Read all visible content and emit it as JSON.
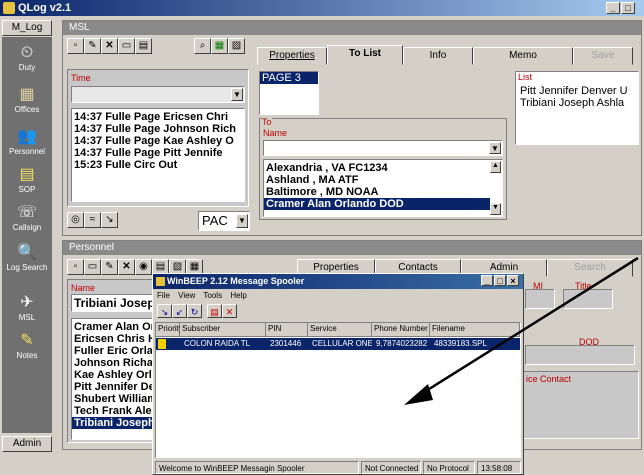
{
  "app": {
    "title": "QLog v2.1"
  },
  "nav": {
    "tab": "M_Log",
    "items": [
      {
        "label": "Duty",
        "icon": "clock-icon"
      },
      {
        "label": "Offices",
        "icon": "building-icon"
      },
      {
        "label": "Personnel",
        "icon": "people-icon"
      },
      {
        "label": "SOP",
        "icon": "book-icon"
      },
      {
        "label": "Callsign",
        "icon": "phone-icon"
      },
      {
        "label": "Log Search",
        "icon": "magnifier-icon"
      },
      {
        "label": "MSL",
        "icon": "satellite-icon"
      },
      {
        "label": "Notes",
        "icon": "notes-icon"
      }
    ],
    "admin": "Admin"
  },
  "msl": {
    "title": "MSL",
    "time_label": "Time",
    "log": [
      "14:37 Fulle Page Ericsen Chri",
      "14:37 Fulle Page Johnson Rich",
      "14:37 Fulle Page Kae Ashley O",
      "14:37 Fulle Page Pitt Jennife",
      "15:23 Fulle Circ Out"
    ],
    "pac": "PAC",
    "tabs": {
      "properties": "Properties",
      "to_list": "To List",
      "info": "Info",
      "memo": "Memo",
      "save": "Save"
    },
    "page_item": "PAGE 3",
    "to_label": "To",
    "name_label": "Name",
    "to_names": [
      "Alexandria , VA FC1234",
      "Ashland , MA ATF",
      "Baltimore , MD NOAA",
      "Cramer Alan Orlando DOD"
    ],
    "list_label": "List",
    "list_items": [
      "Pitt Jennifer Denver U",
      "Tribiani Joseph Ashla"
    ]
  },
  "personnel": {
    "title": "Personnel",
    "name_label": "Name",
    "name_value": "Tribiani Joseph",
    "tabs": {
      "properties": "Properties",
      "contacts": "Contacts",
      "admin": "Admin",
      "search": "Search"
    },
    "names": [
      "Cramer Alan Or",
      "Ericsen Chris H",
      "Fuller Eric Orla",
      "Johnson Richa",
      "Kae Ashley Orla",
      "Pitt Jennifer De",
      "Shubert William",
      "Tech Frank Ale",
      "Tribiani Joseph"
    ],
    "mi_label": "MI",
    "title_label": "Title",
    "dod": "DOD",
    "contact_label": "ice Contact"
  },
  "winbeep": {
    "title": "WinBEEP 2.12 Message Spooler",
    "menu": [
      "File",
      "View",
      "Tools",
      "Help"
    ],
    "columns": [
      "Priority",
      "Subscriber",
      "PIN",
      "Service",
      "Phone Number",
      "Filename"
    ],
    "row": {
      "subscriber": "COLON RAIDA TL",
      "pin": "2301446",
      "service": "CELLULAR ONE",
      "phone": "9,7874023282",
      "filename": "48339183.SPL"
    },
    "status": {
      "welcome": "Welcome to WinBEEP Messagin Spooler",
      "conn": "Not Connected",
      "protocol": "No Protocol",
      "time": "13:58:08"
    }
  }
}
